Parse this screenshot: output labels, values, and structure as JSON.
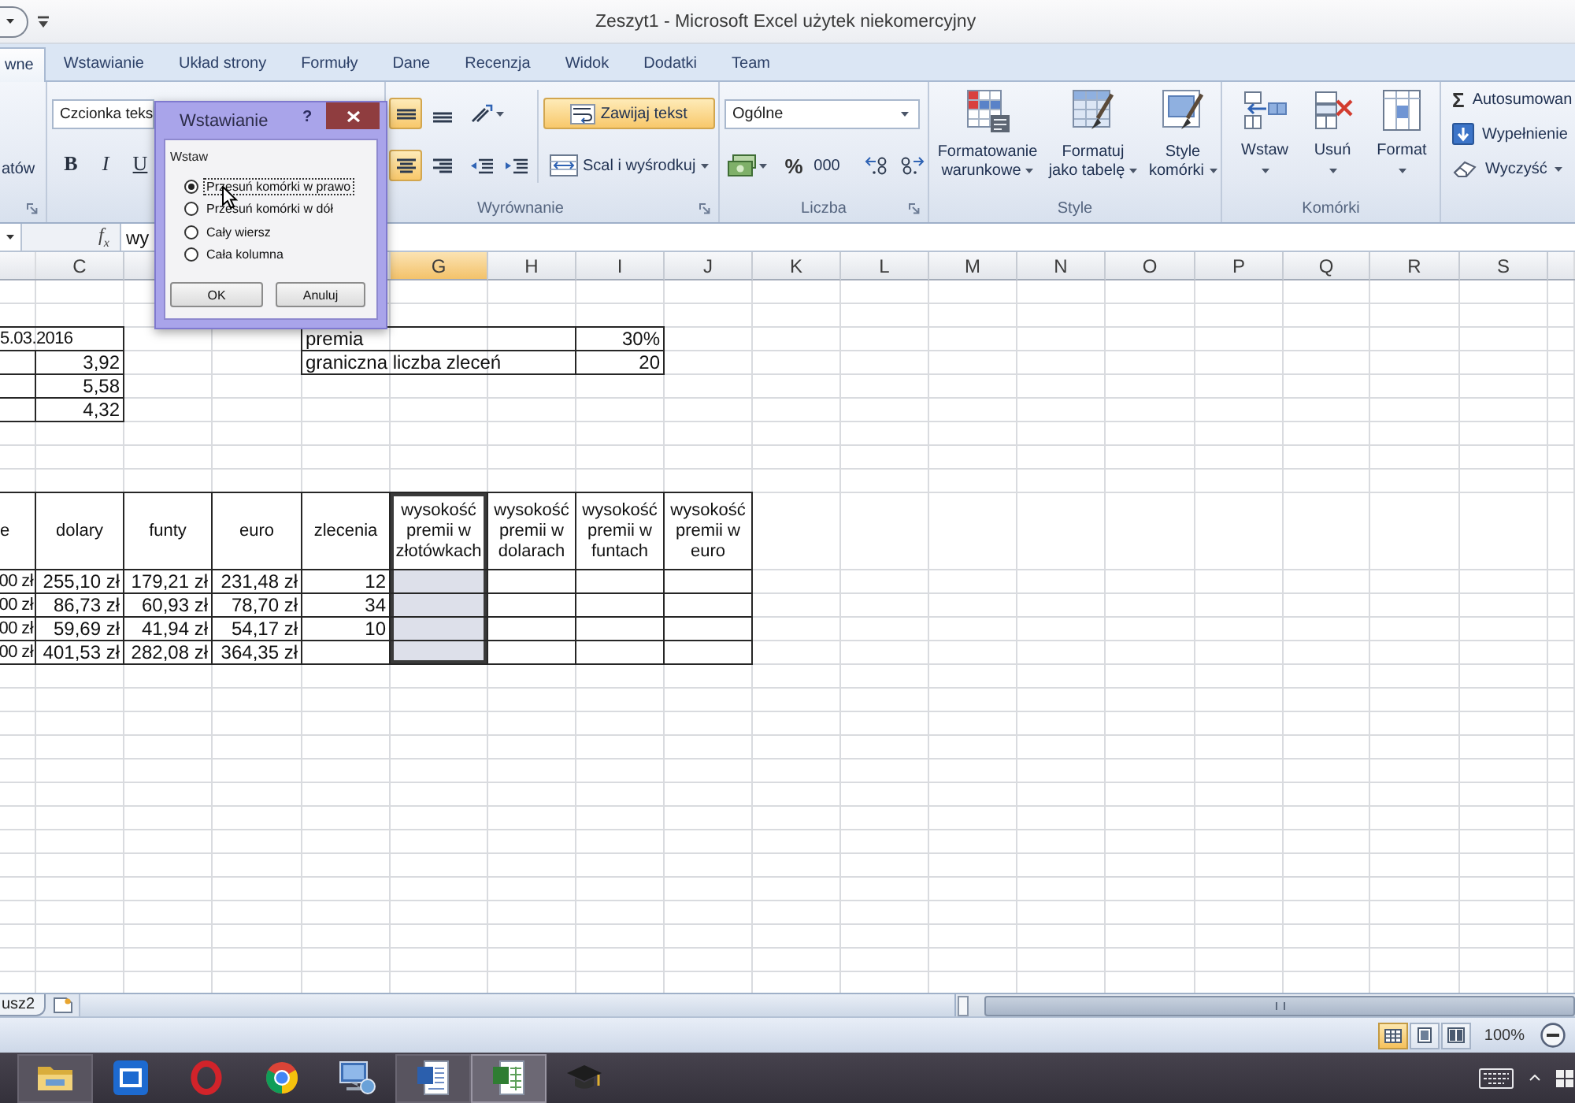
{
  "window": {
    "title": "Zeszyt1 - Microsoft Excel użytek niekomercyjny"
  },
  "ribbon_tabs": [
    {
      "label": "wne",
      "selected": true
    },
    {
      "label": "Wstawianie",
      "selected": false
    },
    {
      "label": "Układ strony",
      "selected": false
    },
    {
      "label": "Formuły",
      "selected": false
    },
    {
      "label": "Dane",
      "selected": false
    },
    {
      "label": "Recenzja",
      "selected": false
    },
    {
      "label": "Widok",
      "selected": false
    },
    {
      "label": "Dodatki",
      "selected": false
    },
    {
      "label": "Team",
      "selected": false
    }
  ],
  "ribbon": {
    "clipboard": {
      "button_label": "atów"
    },
    "font": {
      "font_name": "Czcionka teks",
      "style_buttons": [
        {
          "kind": "bold",
          "label": "B"
        },
        {
          "kind": "italic",
          "label": "I"
        },
        {
          "kind": "underline",
          "label": "U"
        }
      ]
    },
    "alignment": {
      "label": "Wyrównanie",
      "vertical_buttons": [
        {
          "kind": "middle",
          "on": true
        },
        {
          "kind": "bottom",
          "on": false
        }
      ],
      "horizontal_buttons": [
        {
          "kind": "center",
          "on": true
        },
        {
          "kind": "right",
          "on": false
        }
      ],
      "wrap_text": {
        "label": "Zawijaj tekst",
        "on": true
      },
      "merge": {
        "label": "Scal i wyśrodkuj"
      }
    },
    "number": {
      "label": "Liczba",
      "format": "Ogólne",
      "percent": "%",
      "thousands": "000"
    },
    "styles": {
      "label": "Style",
      "buttons": [
        {
          "kind": "conditional",
          "lines": [
            "Formatowanie",
            "warunkowe"
          ]
        },
        {
          "kind": "table",
          "lines": [
            "Formatuj",
            "jako tabelę"
          ]
        },
        {
          "kind": "cell",
          "lines": [
            "Style",
            "komórki"
          ]
        }
      ]
    },
    "cells": {
      "label": "Komórki",
      "buttons": [
        {
          "kind": "insert",
          "label": "Wstaw"
        },
        {
          "kind": "delete",
          "label": "Usuń"
        },
        {
          "kind": "format",
          "label": "Format"
        }
      ]
    },
    "editing": [
      {
        "kind": "autosum",
        "symbol": "Σ",
        "label": "Autosumowan"
      },
      {
        "kind": "fill",
        "label": "Wypełnienie"
      },
      {
        "kind": "clear",
        "label": "Wyczyść"
      }
    ]
  },
  "formula_bar": {
    "function_button": "f$_{x}$",
    "value": "wy"
  },
  "sheet": {
    "column_headers": [
      {
        "label": "C",
        "selected": false
      },
      {
        "label": "G",
        "selected": true
      },
      {
        "label": "H",
        "selected": false
      },
      {
        "label": "I",
        "selected": false
      },
      {
        "label": "J",
        "selected": false
      },
      {
        "label": "K",
        "selected": false
      },
      {
        "label": "L",
        "selected": false
      },
      {
        "label": "M",
        "selected": false
      },
      {
        "label": "N",
        "selected": false
      },
      {
        "label": "O",
        "selected": false
      },
      {
        "label": "P",
        "selected": false
      },
      {
        "label": "Q",
        "selected": false
      },
      {
        "label": "R",
        "selected": false
      },
      {
        "label": "S",
        "selected": false
      }
    ],
    "date_box": {
      "date": "5.03.2016",
      "values": [
        "3,92",
        "5,58",
        "4,32"
      ]
    },
    "parameters": [
      {
        "label": "premia",
        "value": "30%"
      },
      {
        "label": "graniczna liczba zleceń",
        "value": "20"
      }
    ],
    "table": {
      "columns": [
        {
          "header": "e",
          "selected": false
        },
        {
          "header": "dolary",
          "selected": false
        },
        {
          "header": "funty",
          "selected": false
        },
        {
          "header": "euro",
          "selected": false
        },
        {
          "header": "zlecenia",
          "selected": false
        },
        {
          "header": "wysokość premii w złotówkach",
          "selected": true
        },
        {
          "header": "wysokość premii w dolarach",
          "selected": false
        },
        {
          "header": "wysokość premii w funtach",
          "selected": false
        },
        {
          "header": "wysokość premii w euro",
          "selected": false
        }
      ],
      "rows": [
        [
          "00 zł",
          "255,10 zł",
          "179,21 zł",
          "231,48 zł",
          "12"
        ],
        [
          "00 zł",
          "86,73 zł",
          "60,93 zł",
          "78,70 zł",
          "34"
        ],
        [
          "00 zł",
          "59,69 zł",
          "41,94 zł",
          "54,17 zł",
          "10"
        ],
        [
          "00 zł",
          "401,53 zł",
          "282,08 zł",
          "364,35 zł"
        ]
      ]
    }
  },
  "dialog": {
    "title": "Wstawianie",
    "help": "?",
    "group_label": "Wstaw",
    "options": [
      {
        "label": "Przesuń komórki w prawo",
        "selected": true,
        "focused": true
      },
      {
        "label": "Przesuń komórki w dół",
        "selected": false,
        "focused": false
      },
      {
        "label": "Cały wiersz",
        "selected": false,
        "focused": false
      },
      {
        "label": "Cała kolumna",
        "selected": false,
        "focused": false
      }
    ],
    "buttons": [
      "OK",
      "Anuluj"
    ]
  },
  "sheet_tabs": [
    {
      "label": "usz2",
      "selected": false
    }
  ],
  "status_bar": {
    "view_buttons": [
      {
        "kind": "normal",
        "selected": true
      },
      {
        "kind": "page_layout",
        "selected": false
      },
      {
        "kind": "page_break",
        "selected": false
      }
    ],
    "zoom": "100%"
  },
  "taskbar": {
    "apps": [
      {
        "kind": "folder",
        "running": true,
        "selected": false
      },
      {
        "kind": "square",
        "running": false,
        "selected": false
      },
      {
        "kind": "ring",
        "running": false,
        "selected": false
      },
      {
        "kind": "segmented",
        "running": false,
        "selected": false
      },
      {
        "kind": "computer",
        "running": false,
        "selected": false
      },
      {
        "kind": "document",
        "running": true,
        "selected": false
      },
      {
        "kind": "spreadsheet",
        "running": true,
        "selected": true
      },
      {
        "kind": "cap",
        "running": false,
        "selected": false
      }
    ]
  }
}
